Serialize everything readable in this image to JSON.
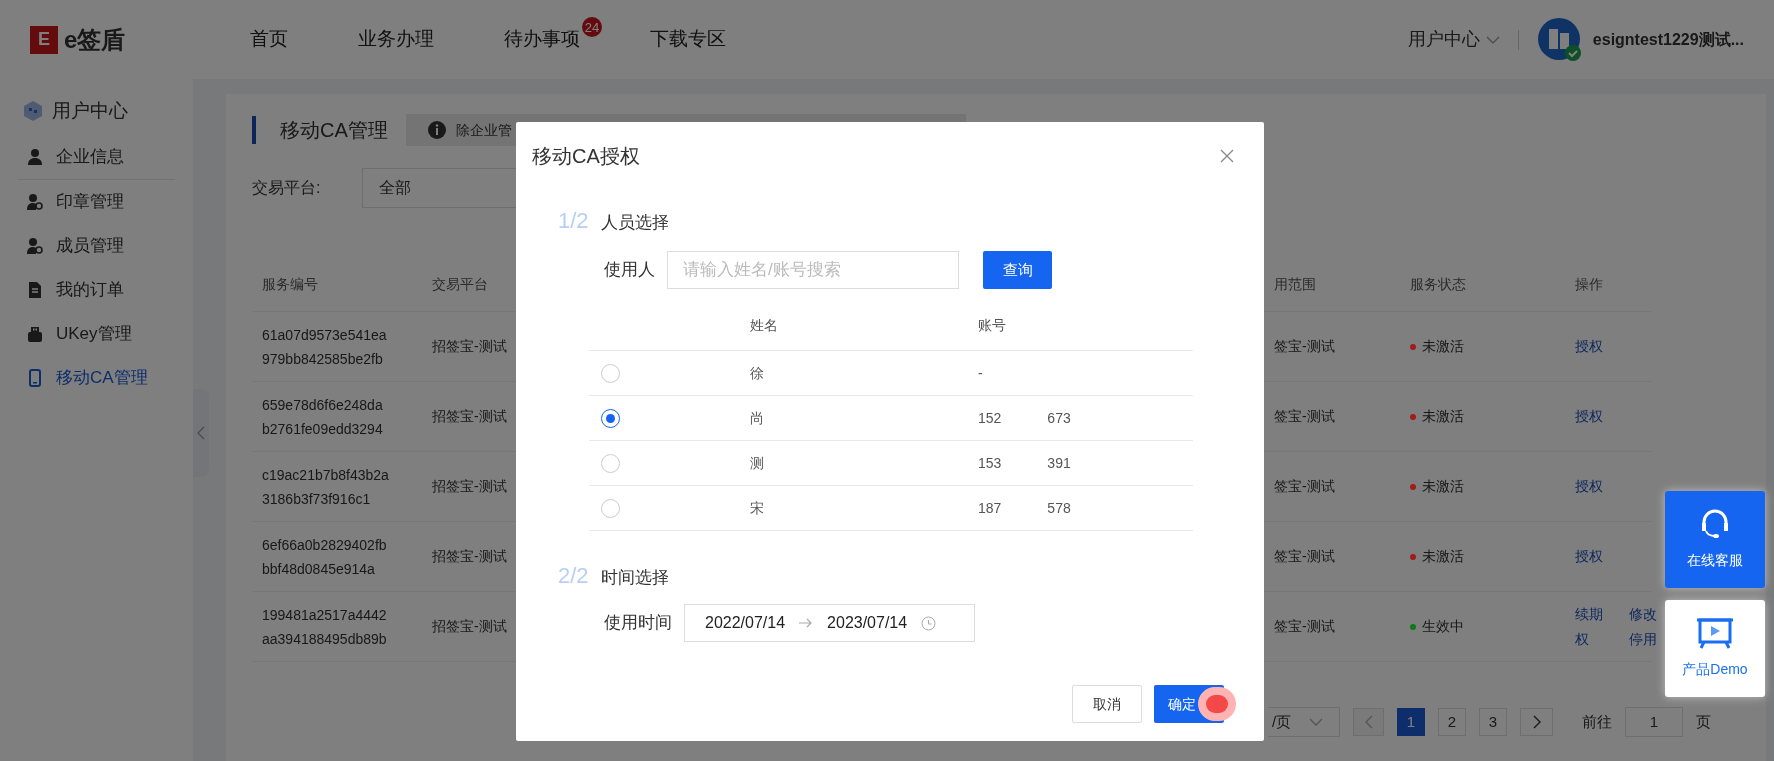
{
  "header": {
    "logo_mark": "E",
    "logo_text": "e签盾",
    "nav": [
      {
        "label": "首页"
      },
      {
        "label": "业务办理"
      },
      {
        "label": "待办事项",
        "badge": "24"
      },
      {
        "label": "下载专区"
      }
    ],
    "user_center": "用户中心",
    "user_name": "esigntest1229测试..."
  },
  "sidebar": {
    "title": "用户中心",
    "items": [
      {
        "label": "企业信息",
        "selected": false
      },
      {
        "label": "印章管理",
        "selected": false
      },
      {
        "label": "成员管理",
        "selected": false
      },
      {
        "label": "我的订单",
        "selected": false
      },
      {
        "label": "UKey管理",
        "selected": false
      },
      {
        "label": "移动CA管理",
        "selected": true
      }
    ]
  },
  "page": {
    "title": "移动CA管理",
    "notice": "除企业管",
    "filter_label": "交易平台:",
    "filter_value": "全部",
    "table": {
      "columns": [
        "服务编号",
        "交易平台",
        "用范围",
        "服务状态",
        "操作"
      ],
      "rows": [
        {
          "service_no": "61a07d9573e541ea 979bb842585be2fb",
          "platform": "招签宝-测试",
          "scope": "签宝-测试",
          "status": "未激活",
          "color": "#a31c1c",
          "actions": [
            "授权"
          ]
        },
        {
          "service_no": "659e78d6f6e248da b2761fe09edd3294",
          "platform": "招签宝-测试",
          "scope": "签宝-测试",
          "status": "未激活",
          "color": "#a31c1c",
          "actions": [
            "授权"
          ]
        },
        {
          "service_no": "c19ac21b7b8f43b2a 3186b3f73f916c1",
          "platform": "招签宝-测试",
          "scope": "签宝-测试",
          "status": "未激活",
          "color": "#a31c1c",
          "actions": [
            "授权"
          ]
        },
        {
          "service_no": "6ef66a0b2829402fb bbf48d0845e914a",
          "platform": "招签宝-测试",
          "scope": "签宝-测试",
          "status": "未激活",
          "color": "#a31c1c",
          "actions": [
            "授权"
          ]
        },
        {
          "service_no": "199481a2517a4442 aa394188495db89b",
          "platform": "招签宝-测试",
          "scope": "签宝-测试",
          "status": "生效中",
          "color": "#0f7a18",
          "actions": [
            "续期",
            "修改",
            "权",
            "停用"
          ]
        }
      ]
    },
    "pagination": {
      "page_size": "/页",
      "pages": [
        {
          "label": "1",
          "selected": true
        },
        {
          "label": "2",
          "selected": false
        },
        {
          "label": "3",
          "selected": false
        }
      ],
      "goto_label": "前往",
      "goto_value": "1",
      "goto_unit": "页"
    }
  },
  "floating": [
    {
      "label": "在线客服",
      "selected": true
    },
    {
      "label": "产品Demo",
      "selected": false
    }
  ],
  "dialog": {
    "title": "移动CA授权",
    "step1": {
      "index": "1/2",
      "title": "人员选择",
      "user_label": "使用人",
      "placeholder": "请输入姓名/账号搜索",
      "query": "查询",
      "columns": [
        "姓名",
        "账号"
      ],
      "rows": [
        {
          "name": "徐",
          "account": [
            "-"
          ],
          "selected": false
        },
        {
          "name": "尚",
          "account": [
            "152",
            "673"
          ],
          "selected": true
        },
        {
          "name": "测",
          "account": [
            "153",
            "391"
          ],
          "selected": false
        },
        {
          "name": "宋",
          "account": [
            "187",
            "578"
          ],
          "selected": false
        }
      ]
    },
    "step2": {
      "index": "2/2",
      "title": "时间选择",
      "time_label": "使用时间",
      "start": "2022/07/14",
      "end": "2023/07/14"
    },
    "cancel": "取消",
    "ok": "确定"
  }
}
